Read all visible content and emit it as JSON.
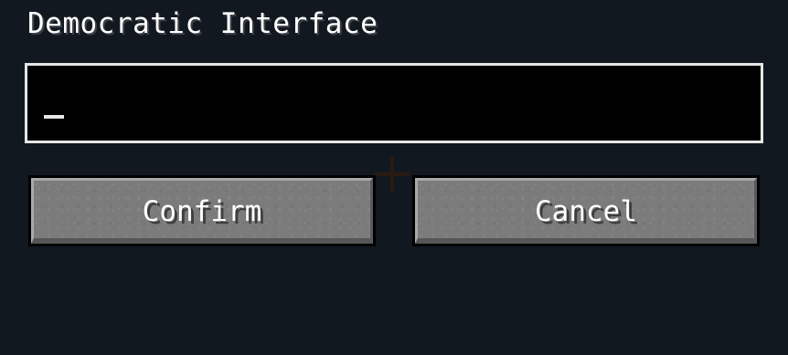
{
  "dialog": {
    "title": "Democratic Interface"
  },
  "input": {
    "value": "",
    "placeholder": ""
  },
  "buttons": {
    "confirm_label": "Confirm",
    "cancel_label": "Cancel"
  },
  "colors": {
    "background": "#121820",
    "field_background": "#000000",
    "field_border": "#e6e6e6",
    "button_face": "#7b7b7b",
    "text": "#ffffff"
  },
  "icons": {
    "crosshair": "crosshair-icon"
  }
}
